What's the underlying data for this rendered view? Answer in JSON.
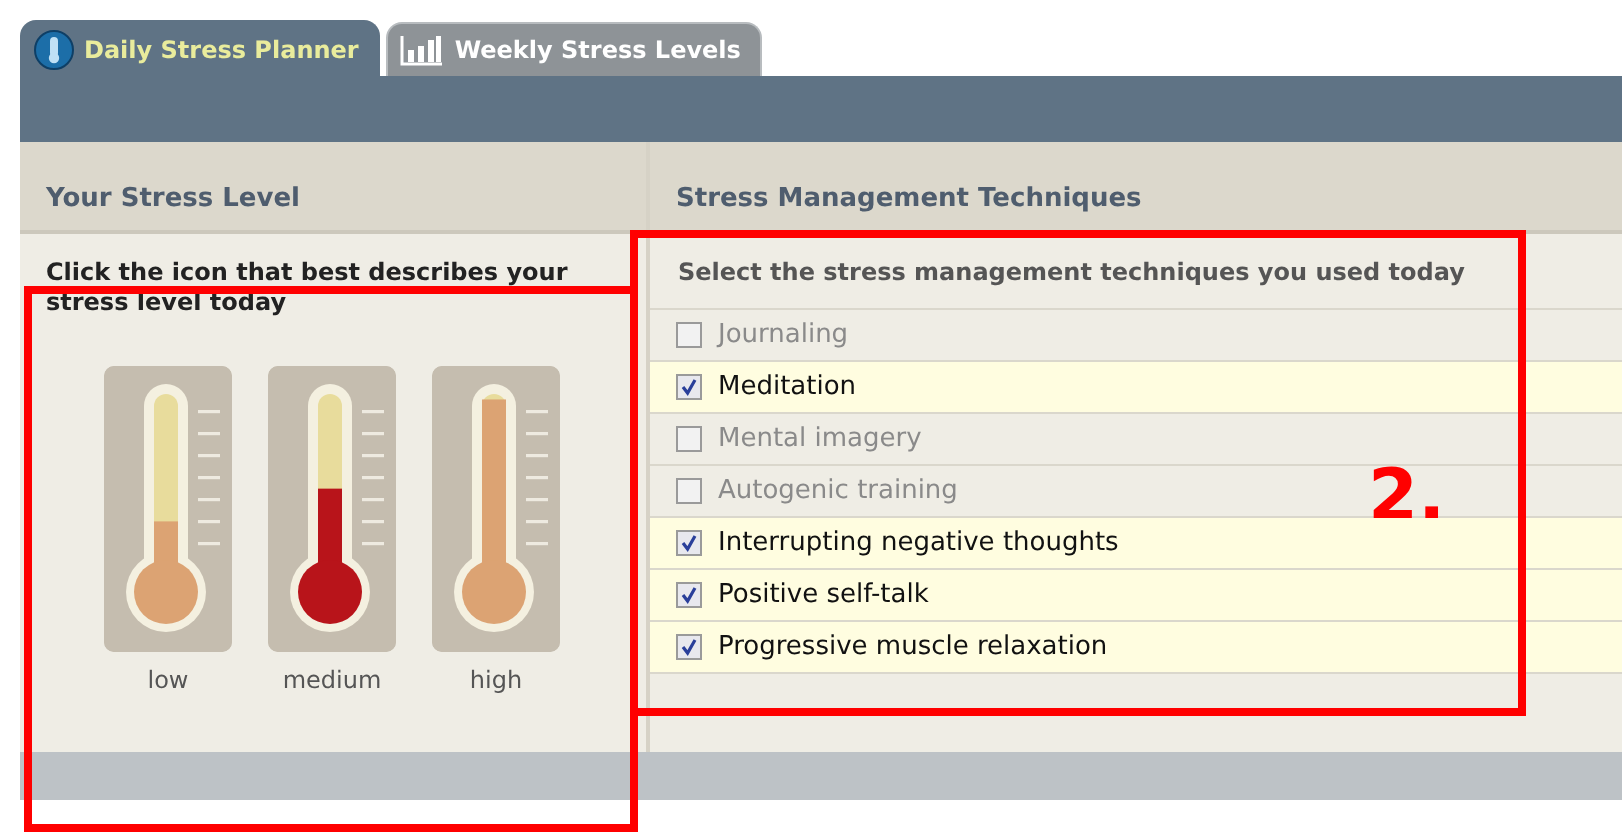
{
  "tabs": [
    {
      "label": "Daily Stress Planner",
      "selected": true,
      "kind": "thermometer"
    },
    {
      "label": "Weekly Stress Levels",
      "selected": false,
      "kind": "chart"
    }
  ],
  "stress_level": {
    "heading": "Your Stress Level",
    "instruction": "Click the icon that best describes your stress level today",
    "options": [
      {
        "label": "low",
        "selected": false
      },
      {
        "label": "medium",
        "selected": true
      },
      {
        "label": "high",
        "selected": false
      }
    ]
  },
  "techniques": {
    "heading": "Stress Management Techniques",
    "instruction": "Select the stress management techniques you used today",
    "items": [
      {
        "label": "Journaling",
        "checked": false
      },
      {
        "label": "Meditation",
        "checked": true
      },
      {
        "label": "Mental imagery",
        "checked": false
      },
      {
        "label": "Autogenic training",
        "checked": false
      },
      {
        "label": "Interrupting negative thoughts",
        "checked": true
      },
      {
        "label": "Positive self-talk",
        "checked": true
      },
      {
        "label": "Progressive muscle relaxation",
        "checked": true
      }
    ]
  },
  "annotations": [
    {
      "label": "2."
    }
  ]
}
